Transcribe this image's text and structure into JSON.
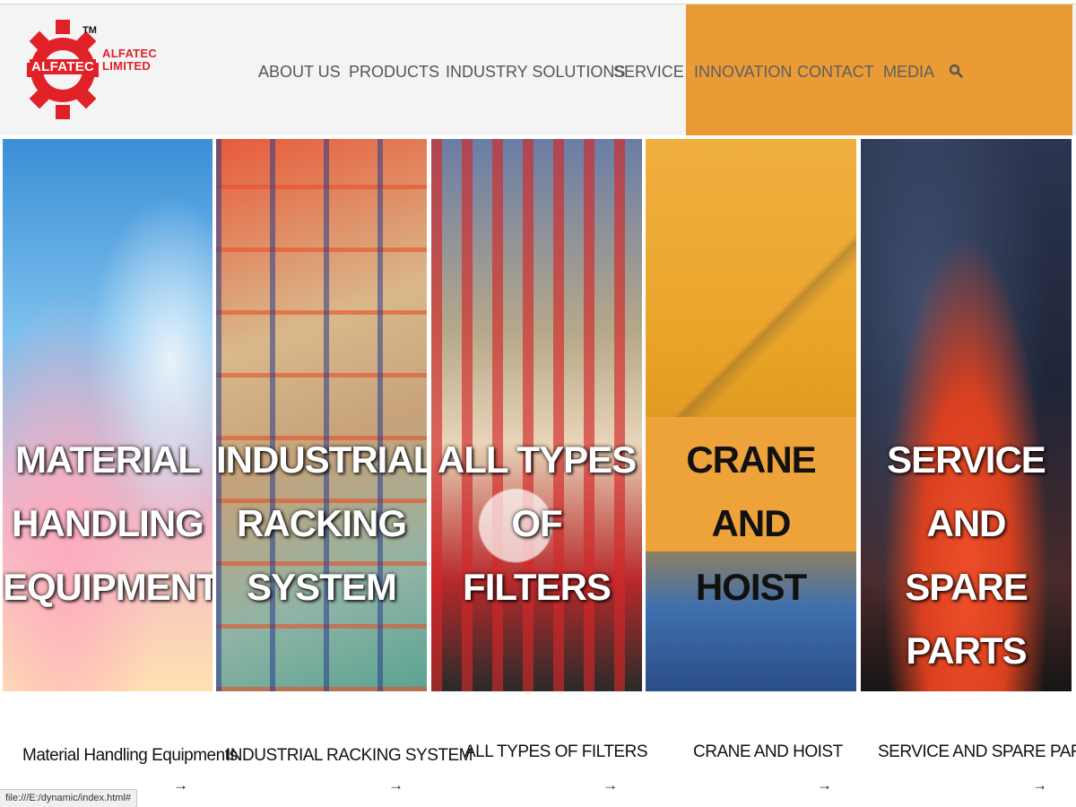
{
  "logo": {
    "trademark": "TM",
    "name": "ALFATEC",
    "company_line1": "ALFATEC",
    "company_line2": "LIMITED"
  },
  "nav": {
    "items": [
      "ABOUT US",
      "PRODUCTS",
      "INDUSTRY SOLUTIONS",
      "SERVICE",
      "INNOVATION",
      "CONTACT",
      "MEDIA"
    ],
    "search_icon": "search-icon"
  },
  "colors": {
    "accent": "#ea9b35",
    "header_bg": "#f4f4f4",
    "brand_red": "#e02128"
  },
  "panels": [
    {
      "lines": [
        "MATERIAL",
        "HANDLING",
        "EQUIPMENTS"
      ],
      "caption": "Material Handling Equipments"
    },
    {
      "lines": [
        "INDUSTRIAL",
        "RACKING",
        "SYSTEM"
      ],
      "caption": "INDUSTRIAL RACKING SYSTEM"
    },
    {
      "lines": [
        "ALL TYPES OF",
        "FILTERS"
      ],
      "caption": "ALL TYPES OF FILTERS"
    },
    {
      "lines": [
        "CRANE AND",
        "HOIST"
      ],
      "caption": "CRANE AND HOIST"
    },
    {
      "lines": [
        "SERVICE AND",
        "SPARE PARTS"
      ],
      "caption": "SERVICE AND SPARE PARTS"
    }
  ],
  "arrow_glyph": "→",
  "status_bar": "file:///E:/dynamic/index.html#"
}
